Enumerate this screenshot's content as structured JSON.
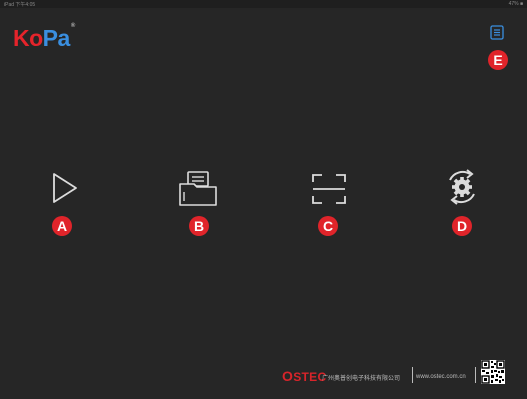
{
  "status_bar": {
    "left": "iPad 下午4:05",
    "right": "47% ■"
  },
  "logo": {
    "part1": "Ko",
    "part2": "Pa",
    "reg": "®"
  },
  "menu_badge": "E",
  "actions": [
    {
      "badge": "A",
      "icon": "play-icon"
    },
    {
      "badge": "B",
      "icon": "folder-icon"
    },
    {
      "badge": "C",
      "icon": "scan-frame-icon"
    },
    {
      "badge": "D",
      "icon": "settings-sync-icon"
    }
  ],
  "footer": {
    "brand_first": "O",
    "brand_rest": "STEC",
    "company": "广州奥普创电子科技有限公司",
    "url": "www.ostec.com.cn"
  },
  "colors": {
    "background": "#262626",
    "badge": "#e0242a",
    "logo_red": "#e5242b",
    "logo_blue": "#3a8fe0",
    "menu_blue": "#3a8fe0"
  }
}
